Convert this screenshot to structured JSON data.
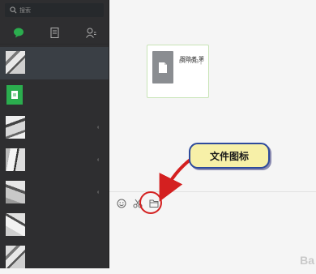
{
  "search": {
    "placeholder": "搜索"
  },
  "sidebar": {
    "tabs": [
      {
        "name": "chat-tab",
        "icon": "chat-bubble-icon",
        "active": true
      },
      {
        "name": "contacts-tab",
        "icon": "contacts-card-icon",
        "active": false
      },
      {
        "name": "profile-tab",
        "icon": "person-icon",
        "active": false
      }
    ],
    "items_count_visible": 7
  },
  "message": {
    "file_name": "跟踪者 第",
    "file_size": "84.7MB |"
  },
  "toolbar": {
    "tools": [
      "smiley-icon",
      "scissors-icon",
      "folder-icon"
    ]
  },
  "annotation": {
    "label": "文件图标",
    "color": "#d42020"
  },
  "watermark": {
    "text": "Ba"
  },
  "colors": {
    "sidebar_bg": "#2e2e30",
    "active_item_bg": "#3a3f45",
    "wechat_green": "#2bad4e",
    "callout_bg": "#f7f0a8",
    "callout_border": "#2e4a9c"
  }
}
